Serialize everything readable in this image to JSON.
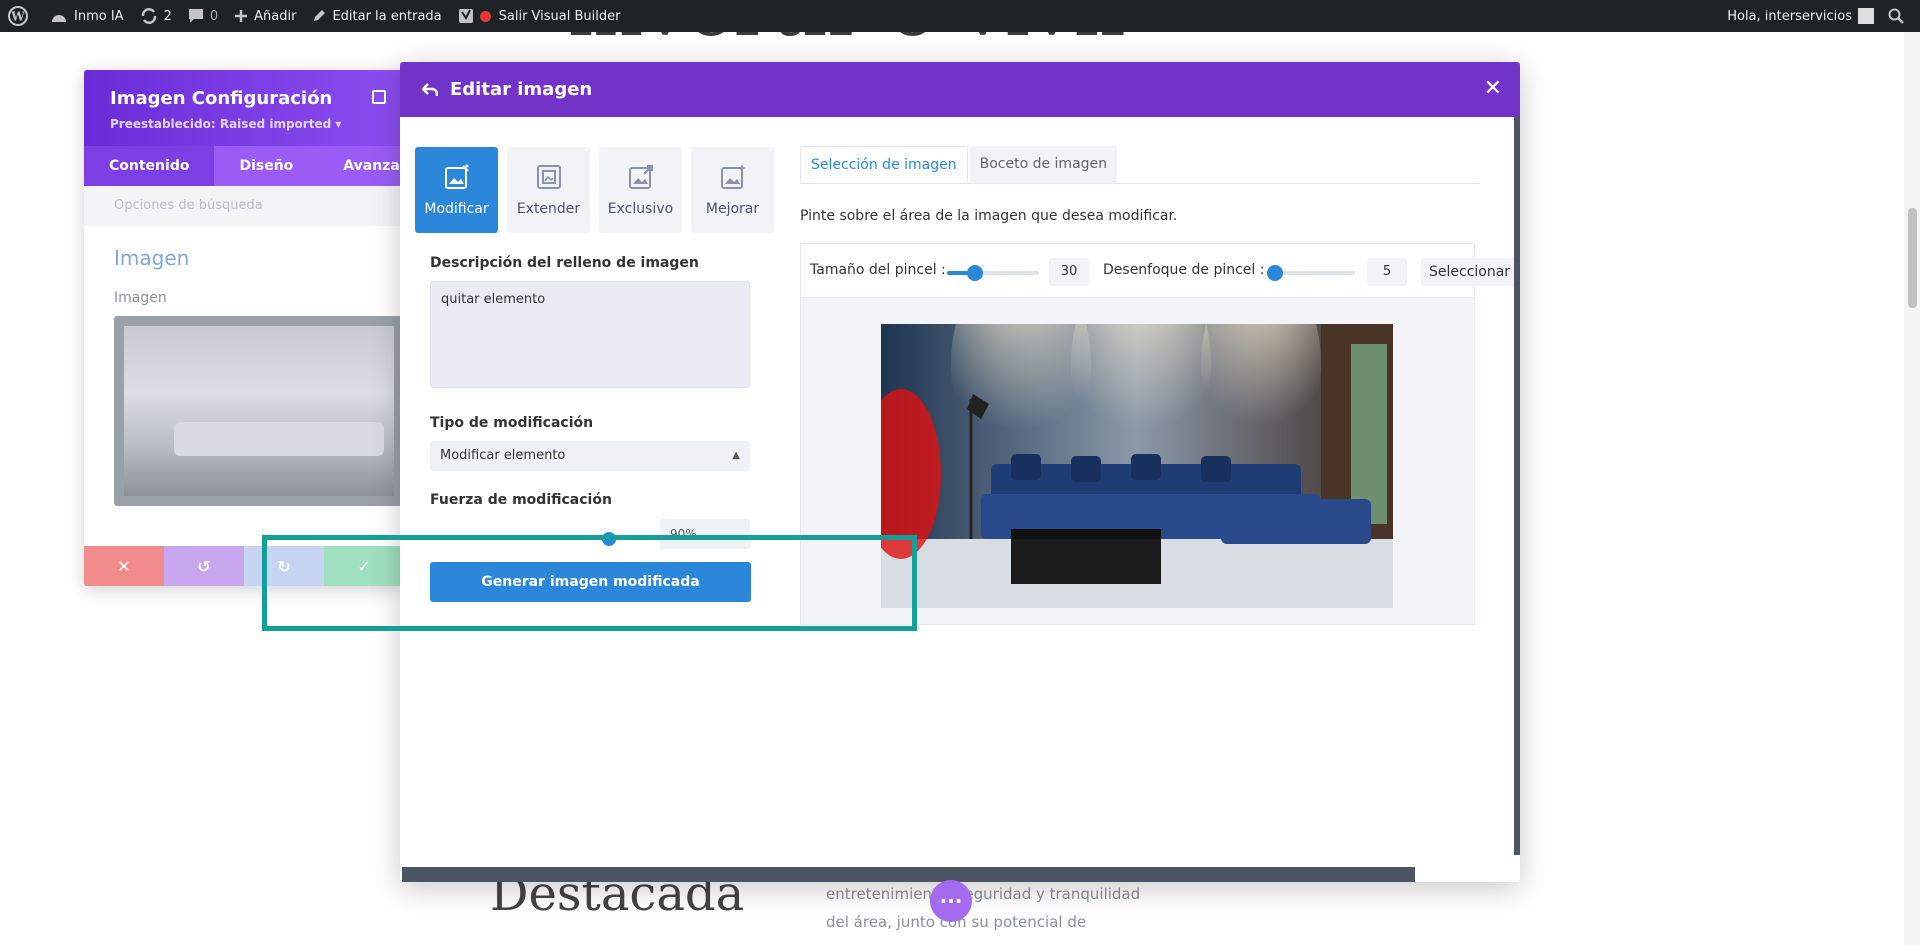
{
  "adminbar": {
    "site_name": "Inmo IA",
    "updates_count": "2",
    "comments_count": "0",
    "add_label": "Añadir",
    "edit_label": "Editar la entrada",
    "exit_label": "Salir Visual Builder",
    "greeting": "Hola, interservicios"
  },
  "background": {
    "title_fragment": "invertir o vivir",
    "heading": "Destacada",
    "text_line1": "entretenimiento, seguridad y tranquilidad",
    "text_line2": "del área, junto con su potencial de"
  },
  "settings": {
    "title": "Imagen Configuración",
    "preset": "Preestablecido: Raised imported ▾",
    "tabs": [
      "Contenido",
      "Diseño",
      "Avanzado"
    ],
    "search_placeholder": "Opciones de búsqueda",
    "group_title": "Imagen",
    "image_label": "Imagen",
    "action_colors": [
      "#f28b8b",
      "#c9a7ef",
      "#c7d4f2",
      "#9fe0c0"
    ]
  },
  "modal": {
    "title": "Editar imagen",
    "modes": [
      {
        "label": "Modificar",
        "icon": "magic-image-icon",
        "active": true
      },
      {
        "label": "Extender",
        "icon": "extend-image-icon",
        "active": false
      },
      {
        "label": "Exclusivo",
        "icon": "exclusive-image-icon",
        "active": false
      },
      {
        "label": "Mejorar",
        "icon": "enhance-image-icon",
        "active": false
      }
    ],
    "fill_description_label": "Descripción del relleno de imagen",
    "fill_description_value": "quitar elemento",
    "mod_type_label": "Tipo de modificación",
    "mod_type_value": "Modificar elemento",
    "strength_label": "Fuerza de modificación",
    "strength_value": "90%",
    "generate_label": "Generar imagen modificada",
    "right_tabs": [
      "Selección de imagen",
      "Boceto de imagen"
    ],
    "paint_instruction": "Pinte sobre el área de la imagen que desea modificar.",
    "brush_size_label": "Tamaño del pincel :",
    "brush_size_value": "30",
    "brush_size_fraction": 0.3,
    "brush_blur_label": "Desenfoque de pincel :",
    "brush_blur_value": "5",
    "brush_blur_fraction": 0.05,
    "select_label": "Seleccionar"
  },
  "colors": {
    "accent": "#2b87da",
    "modal_header": "#7233c9",
    "highlight": "#14a098"
  }
}
